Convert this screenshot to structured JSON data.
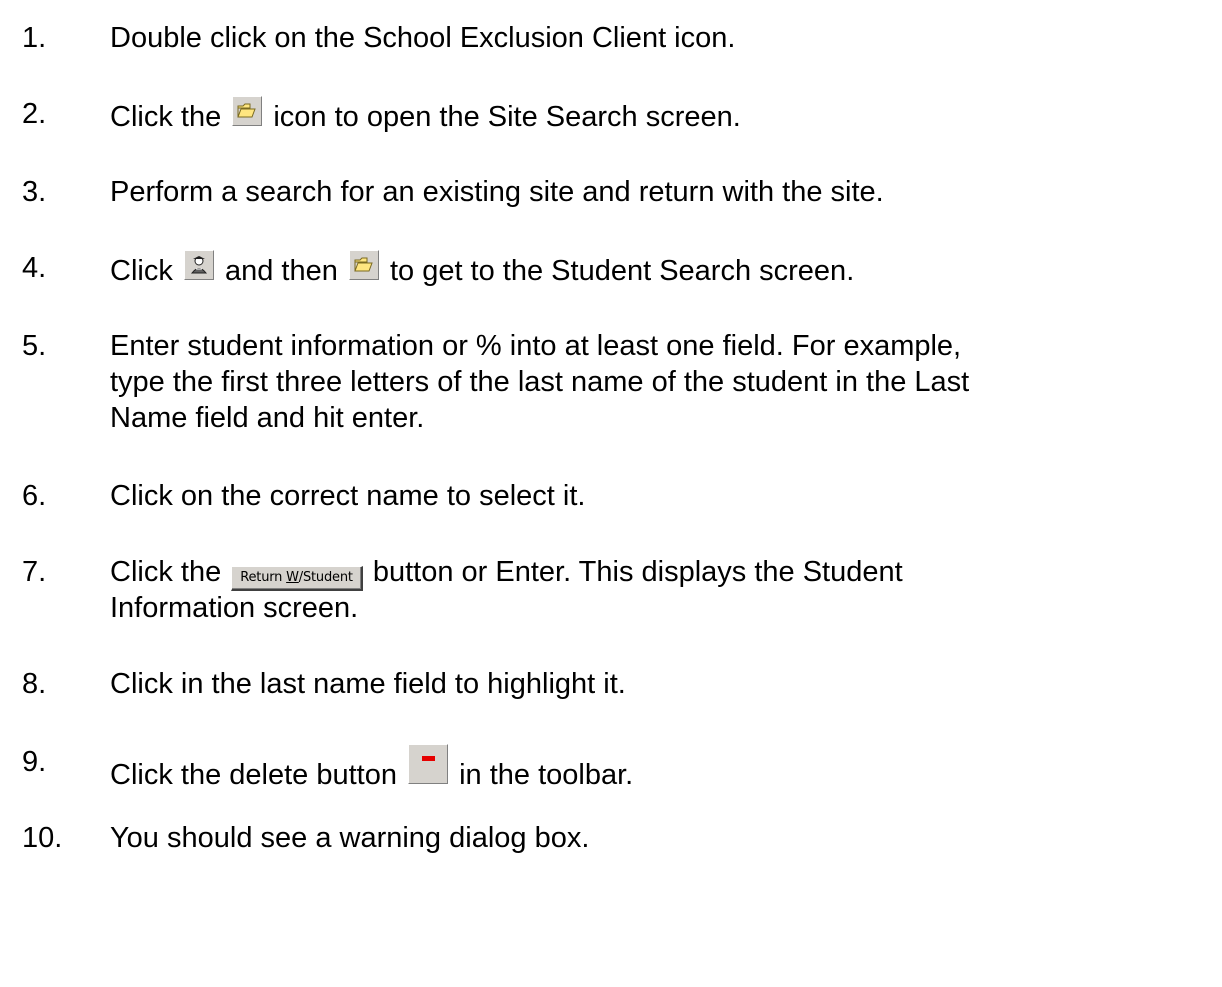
{
  "steps": [
    {
      "num": "1.",
      "text": "Double click on the School Exclusion Client icon."
    },
    {
      "num": "2.",
      "pre": "Click the ",
      "icon": "open-folder-icon",
      "post": " icon to open the Site Search screen."
    },
    {
      "num": "3.",
      "text": "Perform a search for an existing site and return with the site."
    },
    {
      "num": "4.",
      "pre": "Click ",
      "icon1": "student-icon",
      "mid": " and then ",
      "icon2": "open-folder-icon",
      "post": " to get to the Student Search screen."
    },
    {
      "num": "5.",
      "lines": [
        "Enter student information or % into at least one field.  For example,",
        "type the first three letters of the last name of the student in the Last",
        "Name field and hit enter."
      ]
    },
    {
      "num": "6.",
      "text": "Click on the correct name to select it."
    },
    {
      "num": "7.",
      "pre": "Click the ",
      "button_label": "Return W/Student",
      "post": " button or Enter. This displays the Student",
      "line2": "Information screen."
    },
    {
      "num": "8.",
      "text": "Click in the last name field to highlight it."
    },
    {
      "num": "9.",
      "pre": "Click the delete button ",
      "icon": "delete-minus-icon",
      "post": " in the toolbar."
    },
    {
      "num": "10.",
      "text": "You should see a warning dialog box."
    }
  ],
  "colors": {
    "text": "#000000",
    "icon_face": "#d6d3ce",
    "delete_minus": "#e60000",
    "folder_yellow": "#ffe680"
  }
}
